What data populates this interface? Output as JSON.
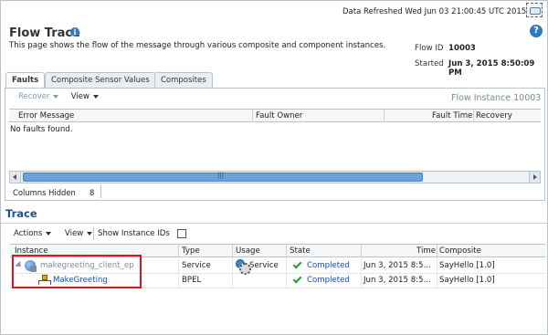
{
  "header": {
    "refresh_text": "Data Refreshed Wed Jun 03 21:00:45 UTC 2015",
    "title": "Flow Trace",
    "description": "This page shows the flow of the message through various composite and component instances.",
    "flow_id_label": "Flow ID",
    "flow_id_value": "10003",
    "started_label": "Started",
    "started_value": "Jun 3, 2015 8:50:09 PM"
  },
  "tabs": [
    {
      "label": "Faults",
      "active": true
    },
    {
      "label": "Composite Sensor Values",
      "active": false
    },
    {
      "label": "Composites",
      "active": false
    }
  ],
  "faults": {
    "recover_label": "Recover",
    "view_label": "View",
    "flow_instance": "Flow Instance 10003",
    "columns": [
      "Error Message",
      "Fault Owner",
      "Fault Time",
      "Recovery"
    ],
    "empty_text": "No faults found.",
    "columns_hidden_label": "Columns Hidden",
    "columns_hidden_value": "8"
  },
  "trace": {
    "title": "Trace",
    "actions_label": "Actions",
    "view_label": "View",
    "show_ids_label": "Show Instance IDs",
    "columns": [
      "Instance",
      "Type",
      "Usage",
      "State",
      "Time",
      "Composite"
    ],
    "rows": [
      {
        "instance": "makegreeting_client_ep",
        "type": "Service",
        "usage": "Service",
        "state": "Completed",
        "time": "Jun 3, 2015 8:5...",
        "composite": "SayHello [1.0]"
      },
      {
        "instance": "MakeGreeting",
        "type": "BPEL",
        "usage": "",
        "state": "Completed",
        "time": "Jun 3, 2015 8:5...",
        "composite": "SayHello [1.0]"
      }
    ]
  },
  "icons": {
    "info": "info-icon",
    "help": "help-icon",
    "refresh": "refresh-icon",
    "service_globe": "globe-icon",
    "bpel": "bpel-component-icon",
    "service_usage": "service-icon",
    "completed": "checkmark-icon"
  },
  "colors": {
    "section_title": "#1f4f87",
    "link": "#1a4fa3",
    "completed": "#2e9a2e",
    "highlight": "#e0141e"
  }
}
